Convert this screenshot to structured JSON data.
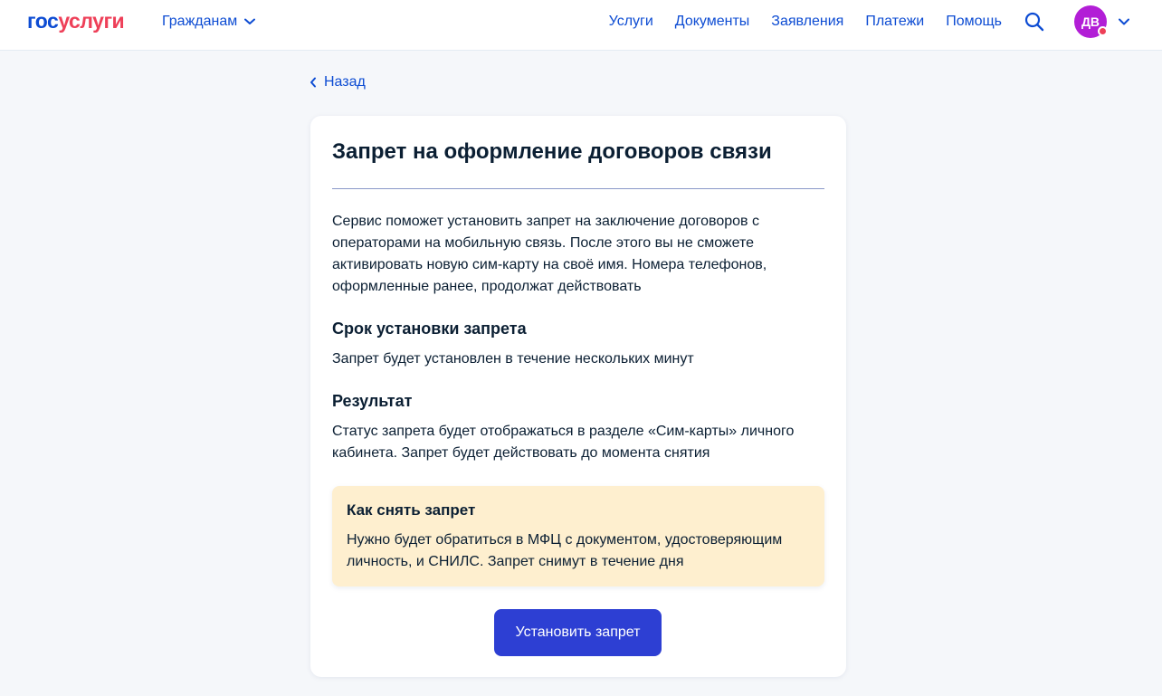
{
  "header": {
    "logo_part1": "гос",
    "logo_part2": "услуги",
    "audience_label": "Гражданам",
    "nav": [
      "Услуги",
      "Документы",
      "Заявления",
      "Платежи",
      "Помощь"
    ],
    "avatar_initials": "ДВ"
  },
  "back_label": "Назад",
  "card": {
    "title": "Запрет на оформление договоров связи",
    "intro": "Сервис поможет установить запрет на заключение договоров с операторами на мобильную связь. После этого вы не сможете активировать новую сим-карту на своё имя. Номера телефонов, оформленные ранее, продолжат действовать",
    "sections": [
      {
        "title": "Срок установки запрета",
        "text": "Запрет будет установлен в течение нескольких минут"
      },
      {
        "title": "Результат",
        "text": "Статус запрета будет отображаться в разделе «Сим-карты» личного кабинета. Запрет будет действовать до момента снятия"
      }
    ],
    "notice": {
      "title": "Как снять запрет",
      "text": "Нужно будет обратиться в МФЦ с документом, удостоверяющим личность, и СНИЛС. Запрет снимут в течение дня"
    },
    "button_label": "Установить запрет"
  },
  "colors": {
    "link": "#0d4cd3",
    "brand_red": "#ee3f58",
    "avatar": "#b21ed6",
    "button": "#2d3fd3",
    "notice_bg": "#feefcf"
  },
  "icons": {
    "audience_chevron": "chevron-down-icon",
    "search": "search-icon",
    "profile_chevron": "chevron-down-icon",
    "back": "chevron-left-icon"
  }
}
